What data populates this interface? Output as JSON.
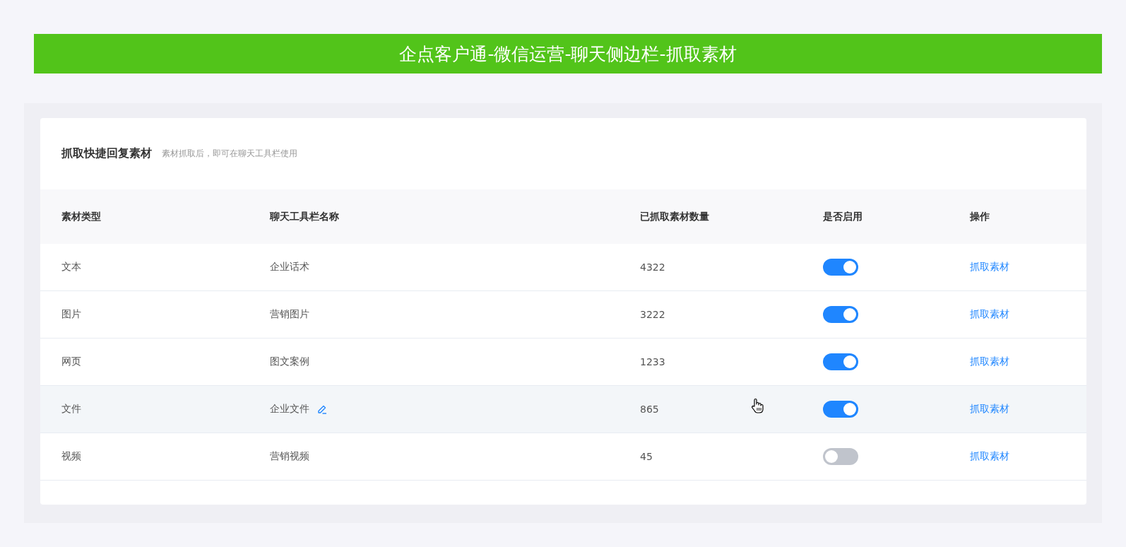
{
  "banner": {
    "title": "企点客户通-微信运营-聊天侧边栏-抓取素材"
  },
  "card": {
    "title": "抓取快捷回复素材",
    "subtitle": "素材抓取后，即可在聊天工具栏使用"
  },
  "table": {
    "columns": [
      "素材类型",
      "聊天工具栏名称",
      "已抓取素材数量",
      "是否启用",
      "操作"
    ],
    "rows": [
      {
        "type": "文本",
        "name": "企业话术",
        "count": "4322",
        "on": true,
        "action": "抓取素材",
        "highlighted": false,
        "editable": false
      },
      {
        "type": "图片",
        "name": "营销图片",
        "count": "3222",
        "on": true,
        "action": "抓取素材",
        "highlighted": false,
        "editable": false
      },
      {
        "type": "网页",
        "name": "图文案例",
        "count": "1233",
        "on": true,
        "action": "抓取素材",
        "highlighted": false,
        "editable": false
      },
      {
        "type": "文件",
        "name": "企业文件",
        "count": "865",
        "on": true,
        "action": "抓取素材",
        "highlighted": true,
        "editable": true
      },
      {
        "type": "视频",
        "name": "营销视频",
        "count": "45",
        "on": false,
        "action": "抓取素材",
        "highlighted": false,
        "editable": false
      }
    ]
  }
}
